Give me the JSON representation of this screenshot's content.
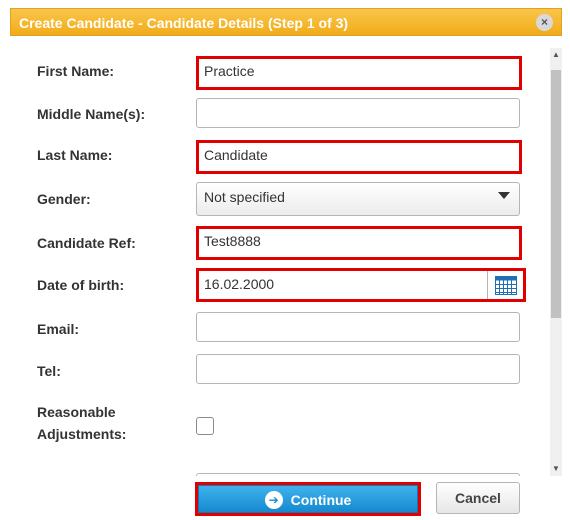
{
  "dialog": {
    "title": "Create Candidate - Candidate Details (Step 1 of 3)",
    "close_icon": "×"
  },
  "form": {
    "first_name": {
      "label": "First Name:",
      "value": "Practice"
    },
    "middle_names": {
      "label": "Middle Name(s):",
      "value": ""
    },
    "last_name": {
      "label": "Last Name:",
      "value": "Candidate"
    },
    "gender": {
      "label": "Gender:",
      "value": "Not specified"
    },
    "candidate_ref": {
      "label": "Candidate Ref:",
      "value": "Test8888"
    },
    "date_of_birth": {
      "label": "Date of birth:",
      "value": "16.02.2000"
    },
    "email": {
      "label": "Email:",
      "value": ""
    },
    "tel": {
      "label": "Tel:",
      "value": ""
    },
    "reasonable_adjustments": {
      "label_line1": "Reasonable",
      "label_line2": "Adjustments:",
      "checked": false
    }
  },
  "buttons": {
    "continue": "Continue",
    "cancel": "Cancel"
  },
  "colors": {
    "title_bar": "#f2ab1a",
    "highlight": "#e10000",
    "continue_button": "#1689cf"
  }
}
